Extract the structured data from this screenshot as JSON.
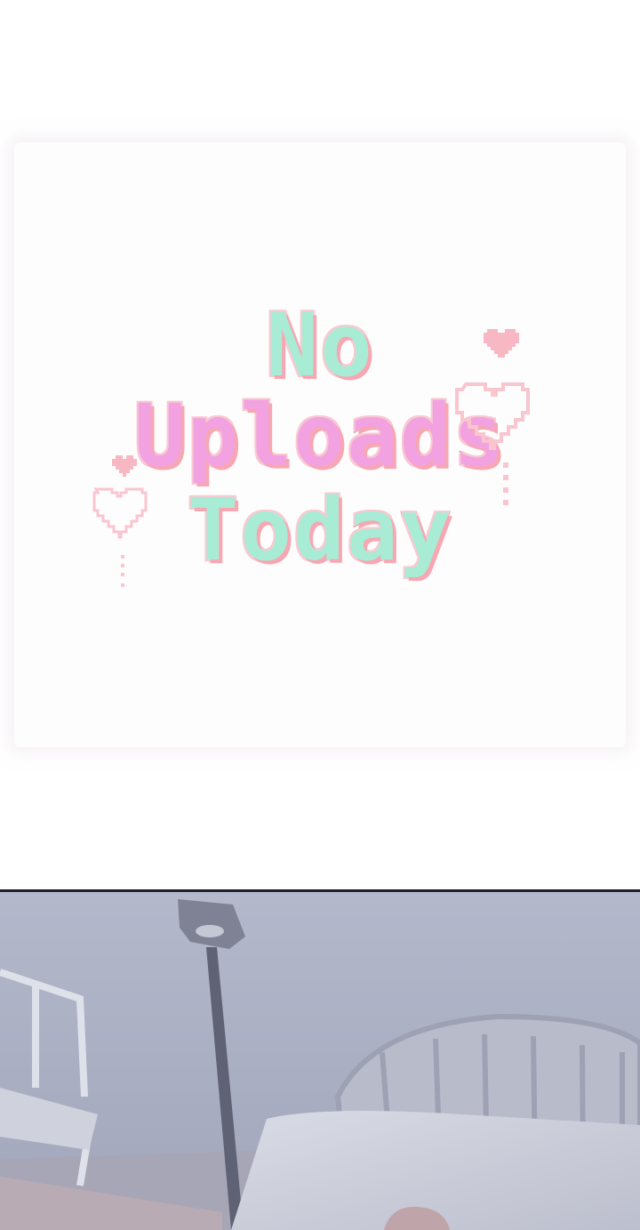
{
  "notice": {
    "title_lines": [
      "No",
      "Uploads",
      "Today"
    ]
  },
  "colors": {
    "mint": "#a8ecd6",
    "pink": "#f2a2e0",
    "outline": "#b96d74",
    "heart": "#f7b7c3",
    "scene_sky": "#a9adc2"
  },
  "decorations": [
    "heart-icon",
    "heart-outline-icon",
    "heart-icon",
    "heart-outline-icon"
  ]
}
